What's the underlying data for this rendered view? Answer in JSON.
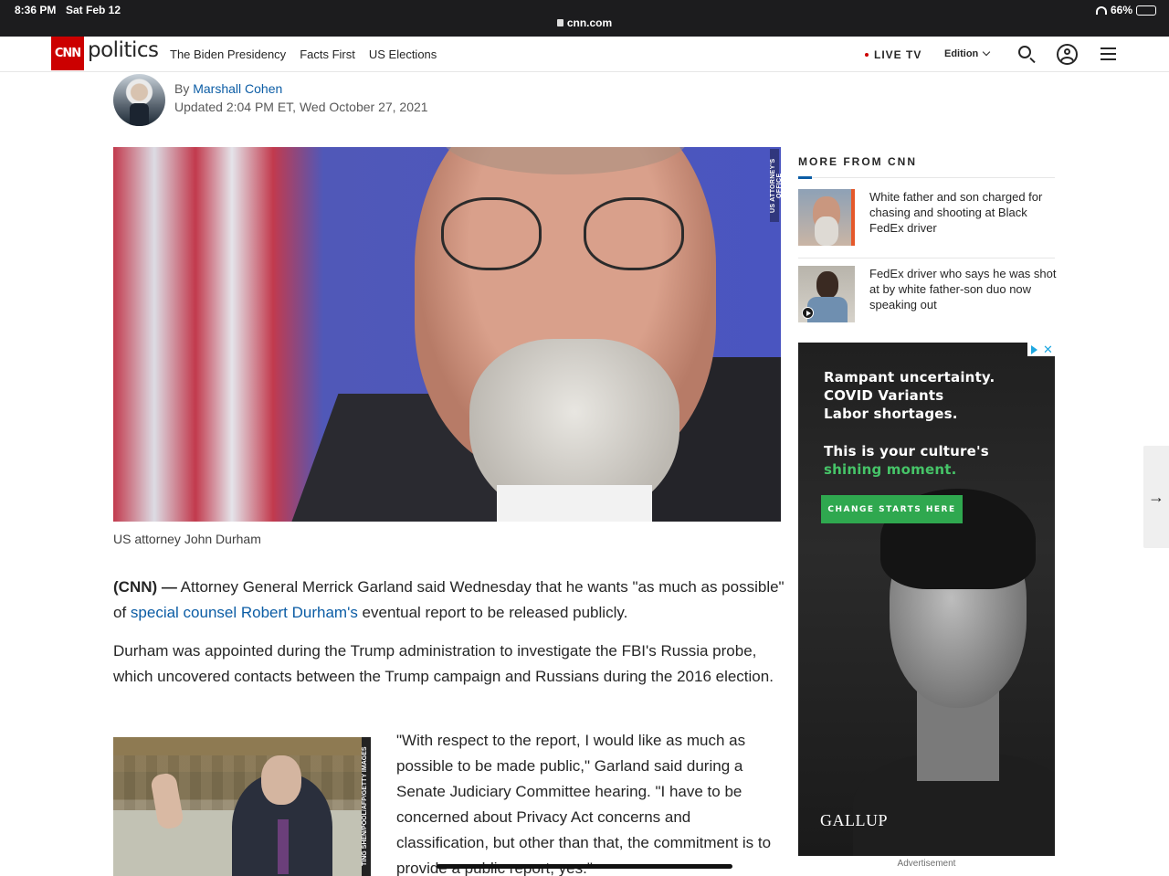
{
  "status_bar": {
    "time": "8:36 PM",
    "date": "Sat Feb 12",
    "url": "cnn.com",
    "battery": "66%",
    "battery_level": 0.66
  },
  "header": {
    "logo": "CNN",
    "section": "politics",
    "nav": [
      "The Biden Presidency",
      "Facts First",
      "US Elections"
    ],
    "live_tv": "LIVE TV",
    "edition": "Edition"
  },
  "byline": {
    "by": "By",
    "author": "Marshall Cohen",
    "updated": "Updated 2:04 PM ET, Wed October 27, 2021"
  },
  "hero": {
    "credit": "US ATTORNEY'S OFFICE",
    "caption": "US attorney John Durham"
  },
  "article": {
    "p1_source": "(CNN) —",
    "p1_a": " Attorney General Merrick Garland said Wednesday that he wants \"as much as possible\" of ",
    "p1_link": "special counsel Robert Durham's",
    "p1_b": " eventual report to be released publicly.",
    "p2": "Durham was appointed during the Trump administration to investigate the FBI's Russia probe, which uncovered contacts between the Trump campaign and Russians during the 2016 election.",
    "p3": "\"With respect to the report, I would like as much as possible to be made public,\" Garland said during a Senate Judiciary Committee hearing. \"I have to be concerned about Privacy Act concerns and classification, but other than that, the commitment is to provide a public report, yes.\"",
    "img2_credit": "TING SHEN/POOL/AFP/GETTY IMAGES"
  },
  "rail": {
    "title": "MORE FROM CNN",
    "items": [
      {
        "text": "White father and son charged for chasing and shooting at Black FedEx driver"
      },
      {
        "text": "FedEx driver who says he was shot at by white father-son duo now speaking out"
      }
    ]
  },
  "ad": {
    "lines": [
      "Rampant uncertainty.",
      "COVID Variants",
      "Labor shortages.",
      "This is your culture's",
      "shining moment."
    ],
    "cta": "CHANGE STARTS HERE",
    "brand": "GALLUP",
    "close": "✕",
    "label": "Advertisement"
  },
  "next_arrow": "→"
}
